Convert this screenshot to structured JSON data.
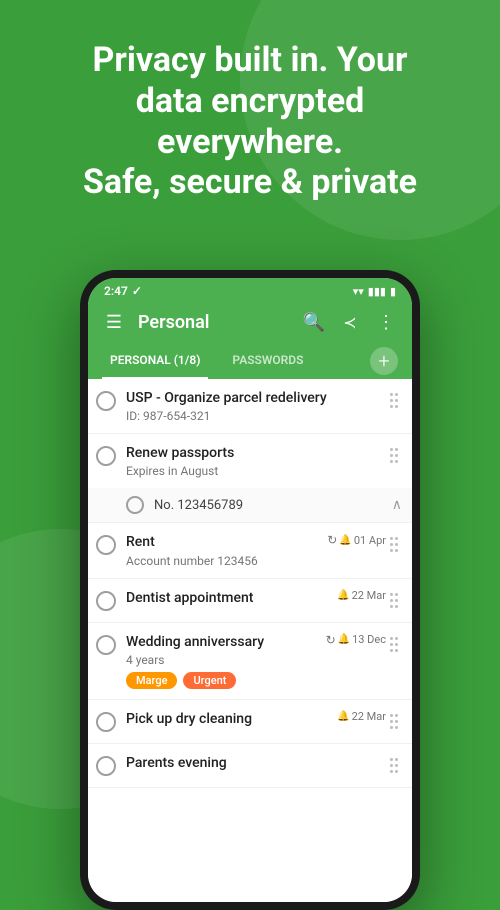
{
  "app": {
    "background_color": "#3a9e3a",
    "header": {
      "line1": "Privacy built in. Your",
      "line2": "data encrypted",
      "line3": "everywhere.",
      "line4": "Safe, secure & private"
    }
  },
  "status_bar": {
    "time": "2:47",
    "check_icon": "✓"
  },
  "toolbar": {
    "menu_icon": "☰",
    "title": "Personal",
    "search_icon": "🔍",
    "share_icon": "⎋",
    "more_icon": "⋮"
  },
  "tabs": [
    {
      "label": "PERSONAL (1/8)",
      "active": true
    },
    {
      "label": "PASSWORDS",
      "active": false
    }
  ],
  "add_button": "+",
  "list_items": [
    {
      "id": "item-1",
      "title": "USP - Organize parcel redelivery",
      "subtitle": "ID: 987-654-321",
      "has_sub": false,
      "right_icons": "",
      "date": ""
    },
    {
      "id": "item-2",
      "title": "Renew passports",
      "subtitle": "Expires in August",
      "has_sub": true,
      "sub_text": "No. 123456789",
      "right_icons": "",
      "date": ""
    },
    {
      "id": "item-3",
      "title": "Rent",
      "subtitle": "Account number 123456",
      "has_sub": false,
      "has_repeat": true,
      "has_bell": true,
      "date": "01 Apr"
    },
    {
      "id": "item-4",
      "title": "Dentist appointment",
      "subtitle": "",
      "has_sub": false,
      "has_repeat": false,
      "has_bell": true,
      "date": "22 Mar"
    },
    {
      "id": "item-5",
      "title": "Wedding anniverssary",
      "subtitle": "4 years",
      "tags": [
        "Marge",
        "Urgent"
      ],
      "has_repeat": true,
      "has_bell": true,
      "date": "13 Dec"
    },
    {
      "id": "item-6",
      "title": "Pick up dry cleaning",
      "subtitle": "",
      "has_bell": true,
      "date": "22 Mar"
    },
    {
      "id": "item-7",
      "title": "Parents evening",
      "subtitle": "",
      "has_bell": false,
      "date": ""
    }
  ],
  "colors": {
    "accent": "#4caf50",
    "tag_marge": "#ff9800",
    "tag_urgent": "#ff6b35",
    "drag_dots": "#bdbdbd"
  }
}
